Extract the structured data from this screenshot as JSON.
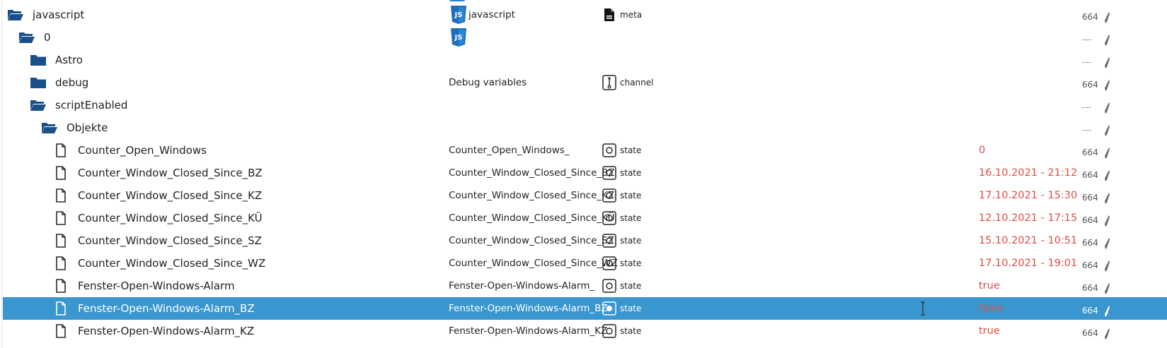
{
  "rows": [
    {
      "name": "javascript",
      "icon": "folder-open-icon",
      "indent": 10,
      "has_js": true,
      "description": "javascript",
      "type_icon": "file-text-icon",
      "type": "meta",
      "value": "",
      "acl": "664"
    },
    {
      "name": "0",
      "icon": "folder-open-icon",
      "indent": 26,
      "has_js": true,
      "description": "",
      "type_icon": "",
      "type": "",
      "value": "",
      "acl": "---"
    },
    {
      "name": "Astro",
      "icon": "folder-icon",
      "indent": 42,
      "has_js": false,
      "description": "",
      "type_icon": "",
      "type": "",
      "value": "",
      "acl": "---"
    },
    {
      "name": "debug",
      "icon": "folder-icon",
      "indent": 42,
      "has_js": false,
      "description": "Debug variables",
      "type_icon": "channel-icon",
      "type": "channel",
      "value": "",
      "acl": "664"
    },
    {
      "name": "scriptEnabled",
      "icon": "folder-open-icon",
      "indent": 42,
      "has_js": false,
      "description": "",
      "type_icon": "",
      "type": "",
      "value": "",
      "acl": "---"
    },
    {
      "name": "Objekte",
      "icon": "folder-open-icon",
      "indent": 58,
      "has_js": false,
      "description": "",
      "type_icon": "",
      "type": "",
      "value": "",
      "acl": "---"
    },
    {
      "name": "Counter_Open_Windows",
      "icon": "file-icon",
      "indent": 74,
      "has_js": false,
      "description": "Counter_Open_Windows_",
      "type_icon": "state-icon",
      "type": "state",
      "value": "0",
      "acl": "664"
    },
    {
      "name": "Counter_Window_Closed_Since_BZ",
      "icon": "file-icon",
      "indent": 74,
      "has_js": false,
      "description": "Counter_Window_Closed_Since_BZ",
      "type_icon": "state-icon",
      "type": "state",
      "value": "16.10.2021 - 21:12",
      "acl": "664"
    },
    {
      "name": "Counter_Window_Closed_Since_KZ",
      "icon": "file-icon",
      "indent": 74,
      "has_js": false,
      "description": "Counter_Window_Closed_Since_KZ",
      "type_icon": "state-icon",
      "type": "state",
      "value": "17.10.2021 - 15:30",
      "acl": "664"
    },
    {
      "name": "Counter_Window_Closed_Since_KÜ",
      "icon": "file-icon",
      "indent": 74,
      "has_js": false,
      "description": "Counter_Window_Closed_Since_KÜ",
      "type_icon": "state-icon",
      "type": "state",
      "value": "12.10.2021 - 17:15",
      "acl": "664"
    },
    {
      "name": "Counter_Window_Closed_Since_SZ",
      "icon": "file-icon",
      "indent": 74,
      "has_js": false,
      "description": "Counter_Window_Closed_Since_SZ",
      "type_icon": "state-icon",
      "type": "state",
      "value": "15.10.2021 - 10:51",
      "acl": "664"
    },
    {
      "name": "Counter_Window_Closed_Since_WZ",
      "icon": "file-icon",
      "indent": 74,
      "has_js": false,
      "description": "Counter_Window_Closed_Since_WZ",
      "type_icon": "state-icon",
      "type": "state",
      "value": "17.10.2021 - 19:01",
      "acl": "664"
    },
    {
      "name": "Fenster-Open-Windows-Alarm",
      "icon": "file-icon",
      "indent": 74,
      "has_js": false,
      "description": "Fenster-Open-Windows-Alarm_",
      "type_icon": "state-icon",
      "type": "state",
      "value": "true",
      "acl": "664"
    },
    {
      "name": "Fenster-Open-Windows-Alarm_BZ",
      "icon": "file-icon",
      "indent": 74,
      "has_js": false,
      "description": "Fenster-Open-Windows-Alarm_BZ",
      "type_icon": "state-icon",
      "type": "state",
      "value": "false",
      "acl": "664",
      "selected": true
    },
    {
      "name": "Fenster-Open-Windows-Alarm_KZ",
      "icon": "file-icon",
      "indent": 74,
      "has_js": false,
      "description": "Fenster-Open-Windows-Alarm_KZ",
      "type_icon": "state-icon",
      "type": "state",
      "value": "true",
      "acl": "664"
    }
  ],
  "colors": {
    "folder": "#1a4f8a",
    "selected_row": "#3a96cf",
    "value_red": "#e04c45",
    "js_badge": "#2a86d8"
  }
}
